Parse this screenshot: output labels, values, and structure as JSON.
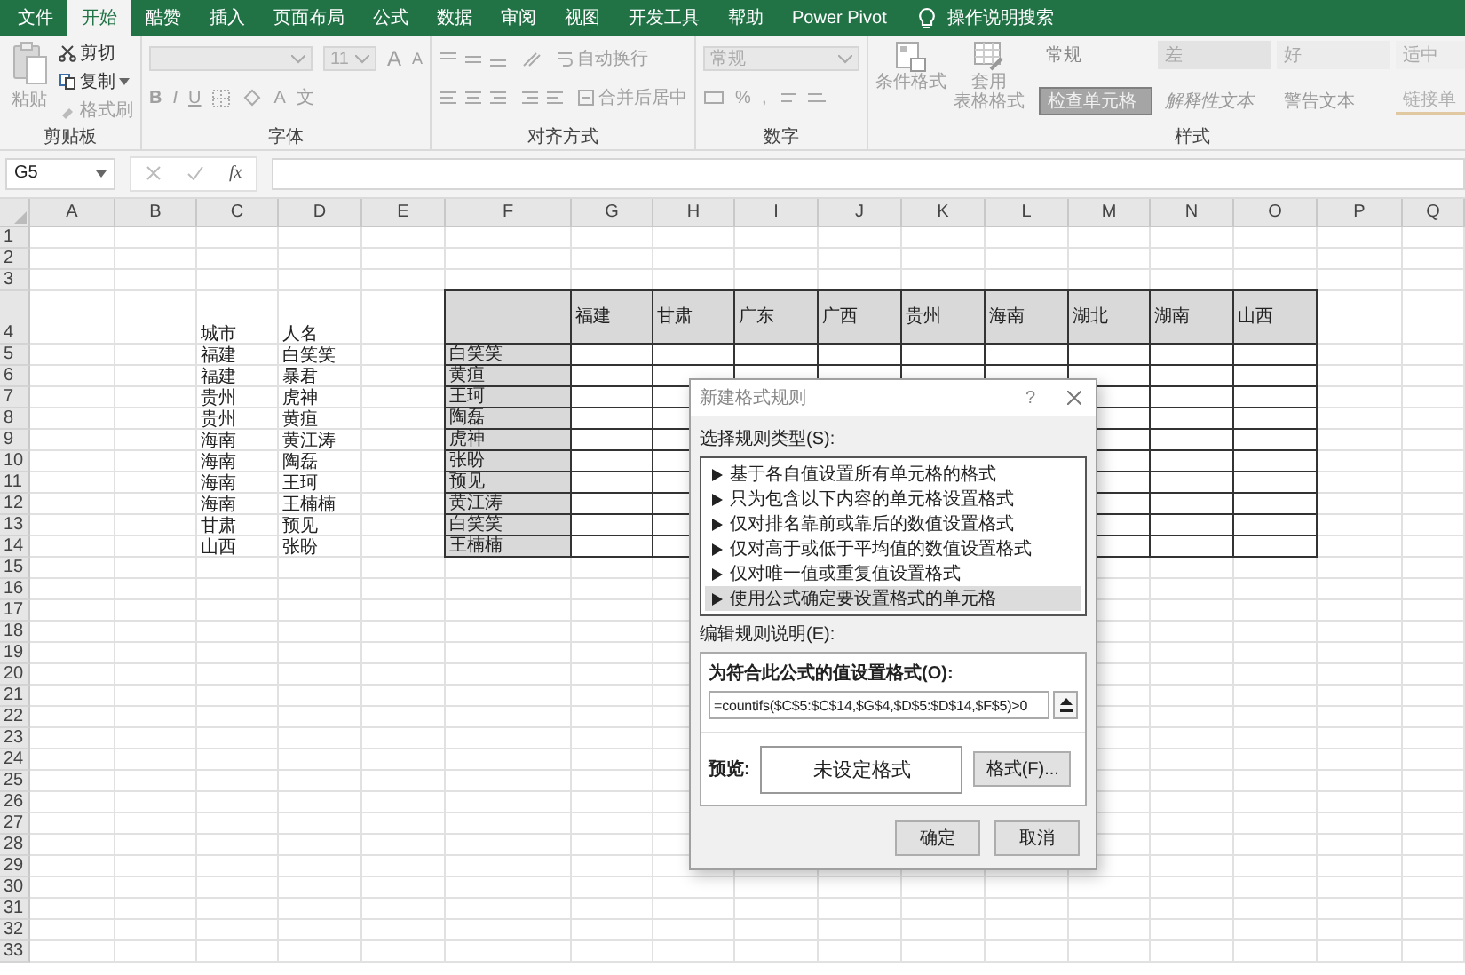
{
  "tabs": [
    {
      "label": "文件",
      "selected": false
    },
    {
      "label": "开始",
      "selected": true
    },
    {
      "label": "酷赞",
      "selected": false
    },
    {
      "label": "插入",
      "selected": false
    },
    {
      "label": "页面布局",
      "selected": false
    },
    {
      "label": "公式",
      "selected": false
    },
    {
      "label": "数据",
      "selected": false
    },
    {
      "label": "审阅",
      "selected": false
    },
    {
      "label": "视图",
      "selected": false
    },
    {
      "label": "开发工具",
      "selected": false
    },
    {
      "label": "帮助",
      "selected": false
    },
    {
      "label": "Power Pivot",
      "selected": false
    }
  ],
  "tell_me": "操作说明搜索",
  "ribbon": {
    "clipboard": {
      "paste": "粘贴",
      "cut": "剪切",
      "copy": "复制",
      "format_painter": "格式刷",
      "label": "剪贴板"
    },
    "font": {
      "size": "11",
      "grow": "A",
      "shrink": "A",
      "bold": "B",
      "italic": "I",
      "underline": "U",
      "font_color": "A",
      "phonetic": "文",
      "label": "字体"
    },
    "alignment": {
      "wrap": "自动换行",
      "merge": "合并后居中",
      "label": "对齐方式"
    },
    "number": {
      "format": "常规",
      "percent": "%",
      "comma": ",",
      "label": "数字"
    },
    "styles": {
      "conditional": "条件格式",
      "table_format": [
        "套用",
        "表格格式"
      ],
      "cells": [
        {
          "text": "常规",
          "kind": "normal"
        },
        {
          "text": "差",
          "kind": "bad"
        },
        {
          "text": "好",
          "kind": "good"
        },
        {
          "text": "适中",
          "kind": "neutral"
        },
        {
          "text": "检查单元格",
          "kind": "check"
        },
        {
          "text": "解释性文本",
          "kind": "explanatory"
        },
        {
          "text": "警告文本",
          "kind": "warning"
        },
        {
          "text": "链接单",
          "kind": "linked"
        }
      ],
      "label": "样式"
    }
  },
  "formula_bar": {
    "name_box": "G5",
    "fx": "fx"
  },
  "sheet": {
    "columns": [
      "A",
      "B",
      "C",
      "D",
      "E",
      "F",
      "G",
      "H",
      "I",
      "J",
      "K",
      "L",
      "M",
      "N",
      "O",
      "P",
      "Q"
    ],
    "row_numbers": [
      "1",
      "2",
      "3",
      "4",
      "5",
      "6",
      "7",
      "8",
      "9",
      "10",
      "11",
      "12",
      "13",
      "14",
      "15",
      "16",
      "17",
      "18",
      "19",
      "20",
      "21",
      "22",
      "23",
      "24",
      "25",
      "26",
      "27",
      "28",
      "29",
      "30",
      "31",
      "32",
      "33"
    ],
    "name_table": {
      "headers": [
        "城市",
        "人名"
      ],
      "rows": [
        [
          "福建",
          "白笑笑"
        ],
        [
          "福建",
          "暴君"
        ],
        [
          "贵州",
          "虎神"
        ],
        [
          "贵州",
          "黄疸"
        ],
        [
          "海南",
          "黄江涛"
        ],
        [
          "海南",
          "陶磊"
        ],
        [
          "海南",
          "王珂"
        ],
        [
          "海南",
          "王楠楠"
        ],
        [
          "甘肃",
          "预见"
        ],
        [
          "山西",
          "张盼"
        ]
      ]
    },
    "matrix": {
      "columns": [
        "福建",
        "甘肃",
        "广东",
        "广西",
        "贵州",
        "海南",
        "湖北",
        "湖南",
        "山西"
      ],
      "rows": [
        "白笑笑",
        "黄疸",
        "王珂",
        "陶磊",
        "虎神",
        "张盼",
        "预见",
        "黄江涛",
        "白笑笑",
        "王楠楠"
      ]
    }
  },
  "dialog": {
    "title": "新建格式规则",
    "help": "?",
    "rule_type_label": "选择规则类型(S):",
    "rule_types": [
      {
        "label": "基于各自值设置所有单元格的格式",
        "selected": false
      },
      {
        "label": "只为包含以下内容的单元格设置格式",
        "selected": false
      },
      {
        "label": "仅对排名靠前或靠后的数值设置格式",
        "selected": false
      },
      {
        "label": "仅对高于或低于平均值的数值设置格式",
        "selected": false
      },
      {
        "label": "仅对唯一值或重复值设置格式",
        "selected": false
      },
      {
        "label": "使用公式确定要设置格式的单元格",
        "selected": true
      }
    ],
    "edit_label": "编辑规则说明(E):",
    "formula_label": "为符合此公式的值设置格式(O):",
    "formula": "=countifs($C$5:$C$14,$G$4,$D$5:$D$14,$F$5)>0",
    "preview_label": "预览:",
    "preview": "未设定格式",
    "format_button": "格式(F)...",
    "ok": "确定",
    "cancel": "取消"
  }
}
